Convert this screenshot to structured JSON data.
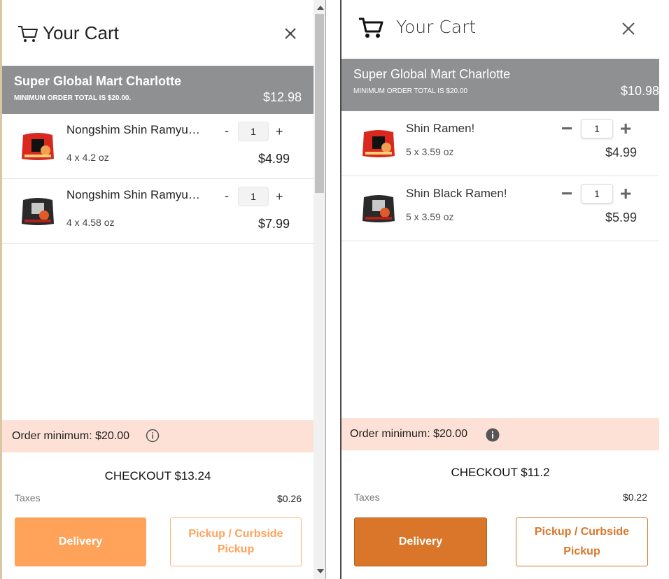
{
  "left_panel": {
    "title": "Your Cart",
    "store": {
      "name": "Super Global Mart Charlotte",
      "minimum_note": "MINIMUM ORDER TOTAL IS $20.00.",
      "subtotal": "$12.98"
    },
    "items": [
      {
        "name": "Nongshim Shin Ramyu…",
        "size": "4 x 4.2 oz",
        "qty": "1",
        "minus": "-",
        "plus": "+",
        "price": "$4.99"
      },
      {
        "name": "Nongshim Shin Ramyu…",
        "size": "4 x 4.58 oz",
        "qty": "1",
        "minus": "-",
        "plus": "+",
        "price": "$7.99"
      }
    ],
    "order_minimum": "Order minimum: $20.00",
    "checkout": "CHECKOUT $13.24",
    "taxes_label": "Taxes",
    "taxes_value": "$0.26",
    "delivery_label": "Delivery",
    "pickup_line1": "Pickup / Curbside",
    "pickup_line2": "Pickup"
  },
  "right_panel": {
    "title": "Your Cart",
    "store": {
      "name": "Super Global Mart Charlotte",
      "minimum_note": "MINIMUM ORDER TOTAL IS $20.00",
      "subtotal": "$10.98"
    },
    "items": [
      {
        "name": "Shin Ramen!",
        "size": "5 x 3.59 oz",
        "qty": "1",
        "minus": "−",
        "plus": "+",
        "price": "$4.99"
      },
      {
        "name": "Shin Black Ramen!",
        "size": "5 x 3.59 oz",
        "qty": "1",
        "minus": "−",
        "plus": "+",
        "price": "$5.99"
      }
    ],
    "order_minimum": "Order minimum: $20.00",
    "checkout": "CHECKOUT $11.2",
    "taxes_label": "Taxes",
    "taxes_value": "$0.22",
    "delivery_label": "Delivery",
    "pickup_line1": "Pickup / Curbside",
    "pickup_line2": "Pickup"
  },
  "colors": {
    "store_bar": "#8e9092",
    "banner": "#fde0d6",
    "delivery_left": "#ffa25a",
    "delivery_right": "#d9762a"
  },
  "icons": [
    "cart-icon",
    "close-icon",
    "info-icon",
    "ramen-package-icon"
  ]
}
